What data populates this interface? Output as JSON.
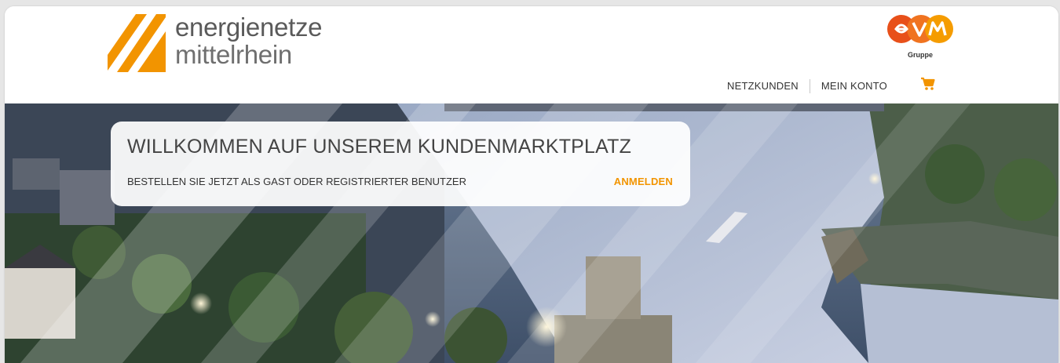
{
  "header": {
    "logo": {
      "line1": "energienetze",
      "line2": "mittelrhein",
      "brand_color": "#f29400"
    },
    "partner_logo": {
      "wordmark": "evm",
      "caption": "Gruppe",
      "brand_color": "#e8501a"
    },
    "nav": {
      "items": [
        {
          "label": "NETZKUNDEN"
        },
        {
          "label": "MEIN KONTO"
        }
      ],
      "cart_icon": "shopping-cart-icon",
      "cart_color": "#f29400"
    }
  },
  "hero": {
    "welcome_title": "WILLKOMMEN AUF UNSEREM KUNDENMARKTPLATZ",
    "welcome_subtitle": "BESTELLEN SIE JETZT ALS GAST ODER REGISTRIERTER BENUTZER",
    "login_label": "ANMELDEN",
    "accent_color": "#f29400"
  }
}
